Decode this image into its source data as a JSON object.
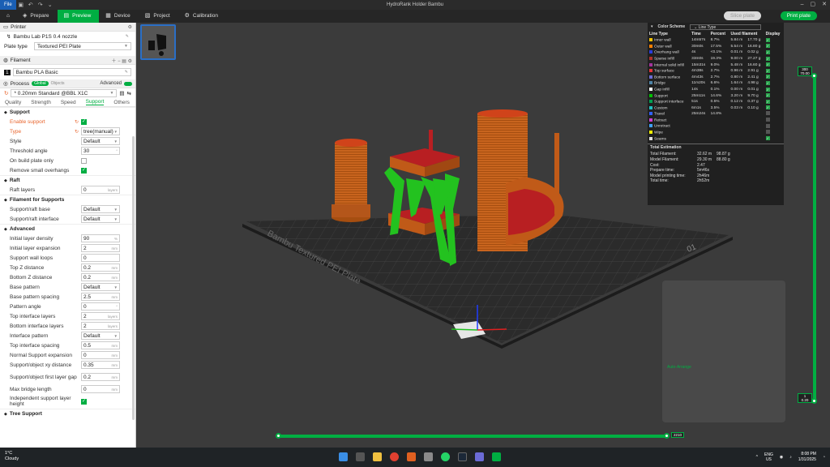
{
  "titlebar": {
    "file_label": "File",
    "title": "HydroRank Holder Bambu"
  },
  "tabs": [
    {
      "label": "Prepare",
      "icon": "prepare-icon"
    },
    {
      "label": "Preview",
      "icon": "preview-icon",
      "active": true
    },
    {
      "label": "Device",
      "icon": "device-icon"
    },
    {
      "label": "Project",
      "icon": "project-icon"
    },
    {
      "label": "Calibration",
      "icon": "calibration-icon"
    }
  ],
  "actions": {
    "slice_label": "Slice plate",
    "print_label": "Print plate"
  },
  "sidebar": {
    "printer_header": "Printer",
    "printer_value": "Bambu Lab P1S 0.4 nozzle",
    "plate_type_label": "Plate type",
    "plate_type_value": "Textured PEI Plate",
    "filament_header": "Filament",
    "filament_index": "1",
    "filament_value": "Bambu PLA Basic",
    "process_header": "Process",
    "process_global": "Global",
    "process_objects": "Objects",
    "advanced_label": "Advanced",
    "process_profile": "* 0.20mm Standard @BBL X1C",
    "process_tabs": [
      "Quality",
      "Strength",
      "Speed",
      "Support",
      "Others"
    ],
    "support_group": "Support",
    "params_support": [
      {
        "label": "Enable support",
        "type": "check",
        "on": true,
        "modified": true
      },
      {
        "label": "Type",
        "type": "dd",
        "value": "tree(manual)",
        "modified": true
      },
      {
        "label": "Style",
        "type": "dd",
        "value": "Default"
      },
      {
        "label": "Threshold angle",
        "type": "num",
        "value": "30",
        "unit": "°"
      },
      {
        "label": "On build plate only",
        "type": "check",
        "on": false
      },
      {
        "label": "Remove small overhangs",
        "type": "check",
        "on": true
      }
    ],
    "raft_group": "Raft",
    "params_raft": [
      {
        "label": "Raft layers",
        "type": "num",
        "value": "0",
        "unit": "layers"
      }
    ],
    "fil_support_group": "Filament for Supports",
    "params_fil": [
      {
        "label": "Support/raft base",
        "type": "dd",
        "value": "Default"
      },
      {
        "label": "Support/raft interface",
        "type": "dd",
        "value": "Default"
      }
    ],
    "advanced_group": "Advanced",
    "params_adv": [
      {
        "label": "Initial layer density",
        "type": "num",
        "value": "90",
        "unit": "%"
      },
      {
        "label": "Initial layer expansion",
        "type": "num",
        "value": "2",
        "unit": "mm"
      },
      {
        "label": "Support wall loops",
        "type": "num",
        "value": "0",
        "unit": ""
      },
      {
        "label": "Top Z distance",
        "type": "num",
        "value": "0.2",
        "unit": "mm"
      },
      {
        "label": "Bottom Z distance",
        "type": "num",
        "value": "0.2",
        "unit": "mm"
      },
      {
        "label": "Base pattern",
        "type": "dd",
        "value": "Default"
      },
      {
        "label": "Base pattern spacing",
        "type": "num",
        "value": "2.5",
        "unit": "mm"
      },
      {
        "label": "Pattern angle",
        "type": "num",
        "value": "0",
        "unit": "°"
      },
      {
        "label": "Top interface layers",
        "type": "num",
        "value": "2",
        "unit": "layers"
      },
      {
        "label": "Bottom interface layers",
        "type": "num",
        "value": "2",
        "unit": "layers"
      },
      {
        "label": "Interface pattern",
        "type": "dd",
        "value": "Default"
      },
      {
        "label": "Top interface spacing",
        "type": "num",
        "value": "0.5",
        "unit": "mm"
      },
      {
        "label": "Normal Support expansion",
        "type": "num",
        "value": "0",
        "unit": "mm"
      },
      {
        "label": "Support/object xy distance",
        "type": "num",
        "value": "0.35",
        "unit": "mm"
      },
      {
        "label": "Support/object first layer gap",
        "type": "num",
        "value": "0.2",
        "unit": "mm",
        "tall": true
      },
      {
        "label": "Max bridge length",
        "type": "num",
        "value": "0",
        "unit": "mm"
      },
      {
        "label": "Independent support layer height",
        "type": "check",
        "on": true,
        "tall": true
      }
    ],
    "tree_group": "Tree Support"
  },
  "legend": {
    "title": "Color Scheme",
    "scheme_value": "Line Type",
    "headers": [
      "Line Type",
      "Time",
      "Percent",
      "Used filament",
      "Display"
    ],
    "rows": [
      {
        "name": "Inner wall",
        "color": "#f2c200",
        "time": "14m57s",
        "pct": "8.7%",
        "m": "5.84 m",
        "g": "17.70 g",
        "on": true
      },
      {
        "name": "Outer wall",
        "color": "#ff7f00",
        "time": "30m0s",
        "pct": "17.5%",
        "m": "5.54 m",
        "g": "16.80 g",
        "on": true
      },
      {
        "name": "Overhang wall",
        "color": "#2a3cdd",
        "time": "4s",
        "pct": "<0.1%",
        "m": "0.01 m",
        "g": "0.02 g",
        "on": true
      },
      {
        "name": "Sparse infill",
        "color": "#b0302a",
        "time": "33m0s",
        "pct": "19.3%",
        "m": "9.00 m",
        "g": "27.27 g",
        "on": true
      },
      {
        "name": "Internal solid infill",
        "color": "#a1339c",
        "time": "15m31s",
        "pct": "9.0%",
        "m": "5.48 m",
        "g": "16.60 g",
        "on": true
      },
      {
        "name": "Top surface",
        "color": "#e6333a",
        "time": "4m38s",
        "pct": "2.7%",
        "m": "0.96 m",
        "g": "2.91 g",
        "on": true
      },
      {
        "name": "Bottom surface",
        "color": "#6b6bd6",
        "time": "4m43s",
        "pct": "2.7%",
        "m": "0.80 m",
        "g": "2.41 g",
        "on": true
      },
      {
        "name": "Bridge",
        "color": "#4d83a6",
        "time": "11m20s",
        "pct": "6.6%",
        "m": "1.64 m",
        "g": "4.98 g",
        "on": true
      },
      {
        "name": "Gap infill",
        "color": "#ffffff",
        "time": "14s",
        "pct": "0.1%",
        "m": "0.00 m",
        "g": "0.01 g",
        "on": true
      },
      {
        "name": "Support",
        "color": "#00c000",
        "time": "25m11s",
        "pct": "14.6%",
        "m": "3.20 m",
        "g": "9.70 g",
        "on": true
      },
      {
        "name": "Support interface",
        "color": "#00a050",
        "time": "51s",
        "pct": "0.5%",
        "m": "0.12 m",
        "g": "0.37 g",
        "on": true
      },
      {
        "name": "Custom",
        "color": "#20c0c0",
        "time": "6m1s",
        "pct": "3.5%",
        "m": "0.03 m",
        "g": "0.10 g",
        "on": true
      },
      {
        "name": "Travel",
        "color": "#3060ff",
        "time": "25m24s",
        "pct": "14.8%",
        "m": "",
        "g": "",
        "on": false
      },
      {
        "name": "Retract",
        "color": "#d040d0",
        "time": "",
        "pct": "",
        "m": "",
        "g": "",
        "on": false
      },
      {
        "name": "Unretract",
        "color": "#40a0ff",
        "time": "",
        "pct": "",
        "m": "",
        "g": "",
        "on": false
      },
      {
        "name": "Wipe",
        "color": "#f0f000",
        "time": "",
        "pct": "",
        "m": "",
        "g": "",
        "on": false
      },
      {
        "name": "Seams",
        "color": "#dddddd",
        "time": "",
        "pct": "",
        "m": "",
        "g": "",
        "on": true
      }
    ],
    "estimation_title": "Total Estimation",
    "estimation": [
      {
        "k": "Total Filament:",
        "v1": "32.62 m",
        "v2": "98.87 g"
      },
      {
        "k": "Model Filament:",
        "v1": "29.30 m",
        "v2": "88.80 g"
      },
      {
        "k": "Cost:",
        "v1": "2.47",
        "v2": ""
      },
      {
        "k": "Prepare time:",
        "v1": "5m46s",
        "v2": ""
      },
      {
        "k": "Model printing time:",
        "v1": "2h46m",
        "v2": ""
      },
      {
        "k": "Total time:",
        "v1": "2h52m",
        "v2": ""
      }
    ]
  },
  "plate_label": "Bambu Textured PEI Plate",
  "plate_number": "01",
  "layer_slider": {
    "top_layer": "300",
    "top_height": "70.00",
    "bottom_layer": "1",
    "bottom_height": "0.20"
  },
  "move_slider": {
    "value": "2210"
  },
  "toast": {
    "title": "Auto-Arrange"
  },
  "taskbar": {
    "temp": "1°C",
    "weather": "Cloudy",
    "lang1": "ENG",
    "lang2": "US",
    "time": "8:08 PM",
    "date": "1/31/2025"
  }
}
